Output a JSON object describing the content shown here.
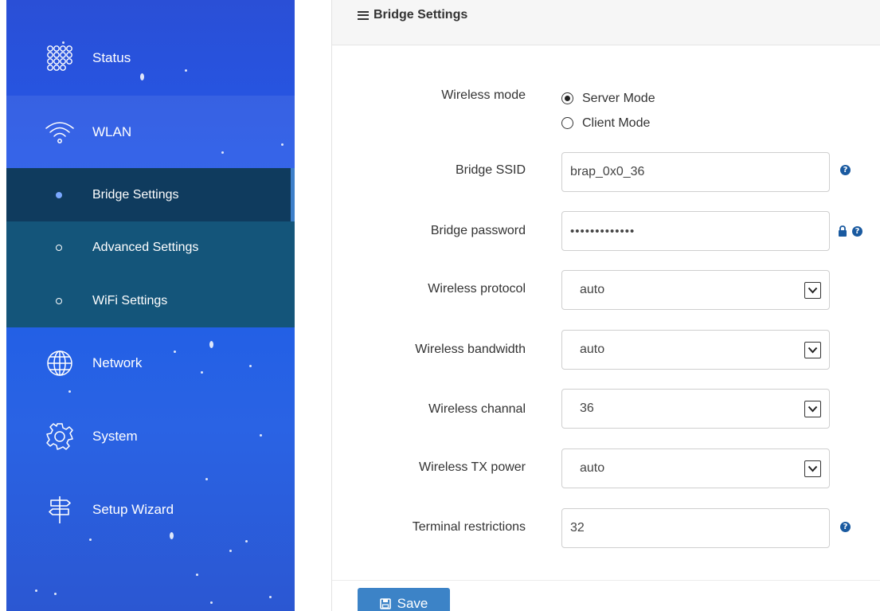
{
  "sidebar": {
    "items": [
      {
        "label": "Status",
        "icon": "grid-dots-icon"
      },
      {
        "label": "WLAN",
        "icon": "wifi-icon"
      },
      {
        "label": "Network",
        "icon": "globe-icon"
      },
      {
        "label": "System",
        "icon": "gear-icon"
      },
      {
        "label": "Setup Wizard",
        "icon": "signpost-icon"
      }
    ],
    "submenu": [
      {
        "label": "Bridge Settings",
        "active": true
      },
      {
        "label": "Advanced Settings",
        "active": false
      },
      {
        "label": "WiFi Settings",
        "active": false
      }
    ]
  },
  "panel": {
    "title": "Bridge Settings"
  },
  "form": {
    "wireless_mode": {
      "label": "Wireless mode",
      "options": [
        "Server Mode",
        "Client Mode"
      ],
      "selected": "Server Mode"
    },
    "bridge_ssid": {
      "label": "Bridge SSID",
      "value": "brap_0x0_36"
    },
    "bridge_password": {
      "label": "Bridge password",
      "value": "•••••••••••••"
    },
    "wireless_protocol": {
      "label": "Wireless protocol",
      "value": "auto"
    },
    "wireless_bandwidth": {
      "label": "Wireless bandwidth",
      "value": "auto"
    },
    "wireless_channel": {
      "label": "Wireless channal",
      "value": "36"
    },
    "wireless_tx_power": {
      "label": "Wireless TX power",
      "value": "auto"
    },
    "terminal_restrictions": {
      "label": "Terminal restrictions",
      "value": "32"
    }
  },
  "actions": {
    "save_label": "Save"
  },
  "colors": {
    "sidebar_blue": "#2557e6",
    "submenu_bg": "#14557a",
    "submenu_active": "#0f3b5e",
    "help_blue": "#1a5aa0",
    "save_button": "#3c83c7"
  }
}
